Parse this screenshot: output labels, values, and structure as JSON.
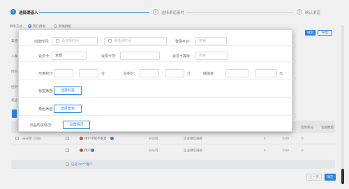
{
  "steps": [
    {
      "num": "1",
      "label": "选择渠道人"
    },
    {
      "num": "2",
      "label": "选择渠道素材"
    },
    {
      "num": "3",
      "label": "确认渠道"
    }
  ],
  "background": {
    "method_label": "群发方式",
    "radio_options": [
      "用户群发",
      "群发群组"
    ],
    "left_labels": [
      "渠道",
      "人群",
      "时间",
      "性别",
      "权益"
    ],
    "search_button": "搜索",
    "export_button": "导出",
    "table_headers": [
      "签到积分",
      "注册数量"
    ],
    "rows": [
      {
        "left": "未分组（258）",
        "name": "用户手填不重复",
        "source": "分公司",
        "channel": "企业微信链接",
        "v1": "0",
        "v2": "0.00",
        "v3": "0"
      },
      {
        "left": "",
        "name": "用户",
        "source": "分公司",
        "channel": "企业微信链接",
        "v1": "0",
        "v2": "0.00",
        "v3": "0"
      }
    ],
    "selected_text": "已选 0/3个用户",
    "prev_button": "上一步",
    "next_button": "确定"
  },
  "popup": {
    "created_time_label": "创建时间:",
    "start_placeholder": "请选择时间",
    "dash": "-",
    "end_placeholder": "请选择时间",
    "platform_label": "登录平台:",
    "platform_placeholder": "搜索",
    "member_label": "会员卡:",
    "member_value": "全部",
    "member_no_label": "会员卡号:",
    "member_level_label": "会员卡等级:",
    "member_level_placeholder": "搜索",
    "points_label": "可用积分:",
    "points_unit": "分",
    "total_points_label": "总积分:",
    "balance_label": "储值金:",
    "balance_unit": "元",
    "tag_label": "标签筛选:",
    "tag_button": "选择标签",
    "role_label": "角色筛选:",
    "role_button": "选择角色",
    "purchase_label": "商品购买情况:",
    "purchase_button": "设置情况"
  },
  "colors": {
    "accent": "#2d8cf0",
    "border": "#d9d9d9"
  }
}
